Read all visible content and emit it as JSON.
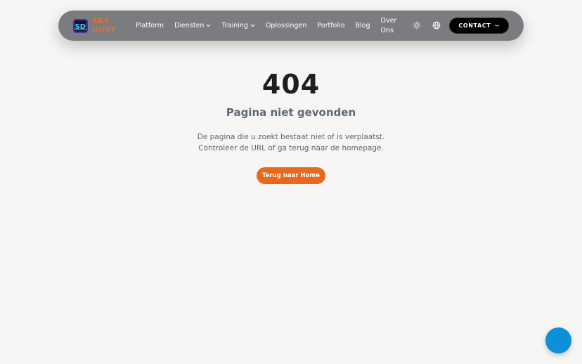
{
  "brand": {
    "logo_icon": "sd-logo-icon",
    "name_line1": "SKY",
    "name_line2": "DUST",
    "accent_color": "#ef6c1f"
  },
  "nav": {
    "items": [
      {
        "label": "Platform",
        "has_dropdown": false
      },
      {
        "label": "Diensten",
        "has_dropdown": true
      },
      {
        "label": "Training",
        "has_dropdown": true
      },
      {
        "label": "Oplossingen",
        "has_dropdown": false
      },
      {
        "label": "Portfolio",
        "has_dropdown": false
      },
      {
        "label": "Blog",
        "has_dropdown": false
      },
      {
        "label": "Over Ons",
        "has_dropdown": false
      }
    ],
    "theme_toggle_icon": "sun-icon",
    "language_icon": "globe-icon",
    "contact_label": "CONTACT",
    "contact_icon": "arrow-right-icon"
  },
  "error": {
    "code": "404",
    "title": "Pagina niet gevonden",
    "description_line1": "De pagina die u zoekt bestaat niet of is verplaatst.",
    "description_line2": "Controleer de URL of ga terug naar de homepage.",
    "home_button_label": "Terug naar Home"
  },
  "colors": {
    "background": "#f7f6f4",
    "navbar": "#7b7c80",
    "primary_button": "#e9691c",
    "chat_button": "#0e8fd9"
  },
  "chat_widget_icon": "chat-bubble-icon"
}
